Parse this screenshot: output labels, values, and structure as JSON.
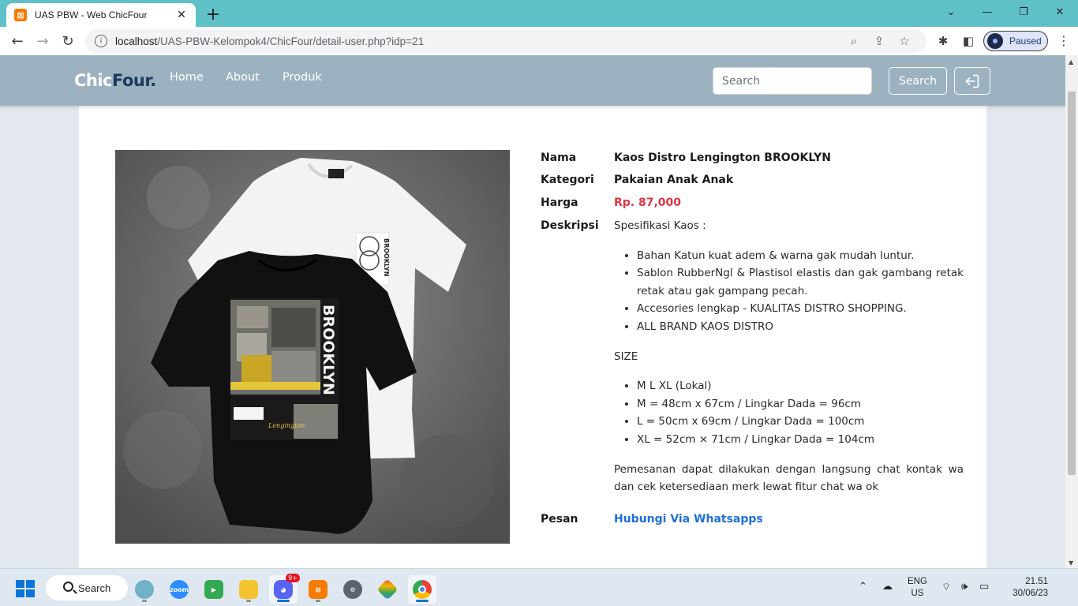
{
  "browser": {
    "tab_title": "UAS PBW - Web ChicFour",
    "url_host": "localhost",
    "url_path": "/UAS-PBW-Kelompok4/ChicFour/detail-user.php?idp=21",
    "profile_status": "Paused"
  },
  "navbar": {
    "brand_part1": "Chic",
    "brand_part2": "Four.",
    "links": [
      "Home",
      "About",
      "Produk"
    ],
    "search_placeholder": "Search",
    "search_button": "Search"
  },
  "product": {
    "labels": {
      "nama": "Nama",
      "kategori": "Kategori",
      "harga": "Harga",
      "deskripsi": "Deskripsi",
      "pesan": "Pesan"
    },
    "nama": "Kaos Distro Lengington BROOKLYN",
    "kategori": "Pakaian Anak Anak",
    "harga": "Rp. 87,000",
    "description": {
      "intro": "Spesifikasi Kaos :",
      "specs": [
        "Bahan Katun kuat adem & warna gak mudah luntur.",
        "Sablon RubberNgl & Plastisol elastis dan gak gambang retak retak atau gak gampang pecah.",
        "Accesories lengkap - KUALITAS DISTRO SHOPPING.",
        "ALL BRAND KAOS DISTRO"
      ],
      "size_heading": "SIZE",
      "sizes": [
        "M L XL (Lokal)",
        "M = 48cm x 67cm / Lingkar Dada = 96cm",
        "L = 50cm x 69cm / Lingkar Dada = 100cm",
        "XL = 52cm × 71cm / Lingkar Dada = 104cm"
      ],
      "closing": "Pemesanan dapat dilakukan dengan langsung chat kontak wa dan cek ketersediaan merk lewat fitur chat wa ok"
    },
    "order_link": "Hubungi Via Whatsapps",
    "image_text": {
      "brooklyn": "BROOKLYN",
      "script": "Lengington"
    }
  },
  "colors": {
    "navbar_bg": "#9cb2c0",
    "page_bg": "#e3e8ee",
    "price": "#dc3545",
    "link": "#1f6fd8",
    "tab_bar": "#5fc0c8"
  },
  "taskbar": {
    "search_label": "Search",
    "discord_badge": "9+",
    "lang_line1": "ENG",
    "lang_line2": "US",
    "time": "21.51",
    "date": "30/06/23"
  }
}
